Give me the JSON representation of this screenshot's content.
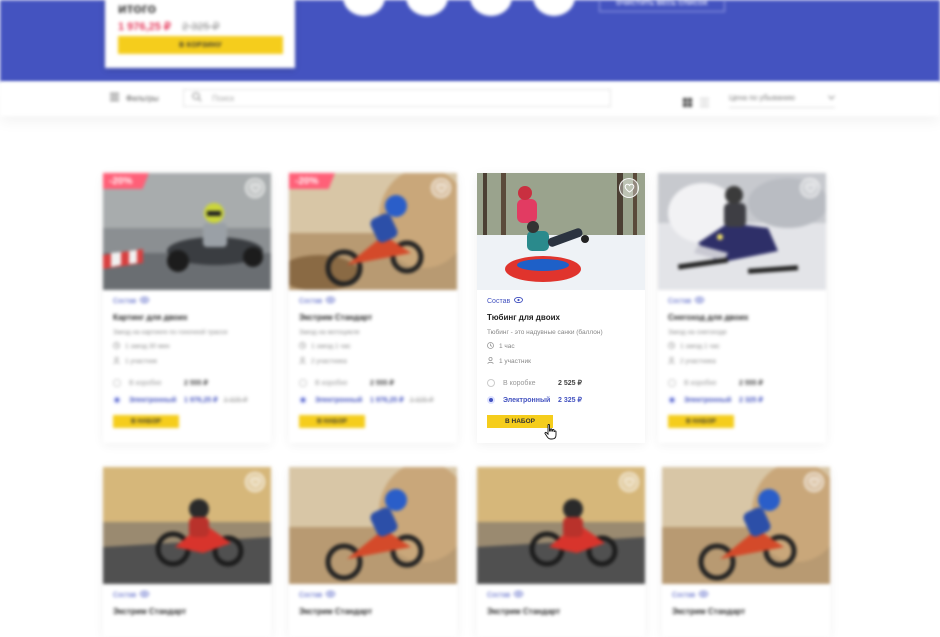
{
  "summary": {
    "title": "итого",
    "price_new": "1 976,25 ₽",
    "price_old": "2 325 ₽",
    "cart_button": "В КОРЗИНУ"
  },
  "header": {
    "clear_button": "ОЧИСТИТЬ ВЕСЬ СПИСОК"
  },
  "toolbar": {
    "filters_label": "Фильтры",
    "search_placeholder": "Поиск",
    "sort_label": "Цена по убыванию"
  },
  "colors": {
    "brand_blue": "#4453c0",
    "accent_yellow": "#f5cd1c",
    "discount_pink": "#ff6078",
    "price_red": "#e53a5c"
  },
  "cards": [
    {
      "badge": "-20%",
      "sostav": "Состав",
      "title": "Картинг для двоих",
      "desc": "Заезд на картинге по гоночной трассе",
      "duration": "1 заезд 30 мин",
      "participants": "1 участник",
      "opt1_label": "В коробке",
      "opt1_price": "2 555 ₽",
      "opt2_label": "Электронный",
      "opt2_price": "1 976,25 ₽",
      "opt2_old": "2 325 ₽",
      "button": "В НАБОР",
      "image": "go-kart-photo"
    },
    {
      "badge": "-20%",
      "sostav": "Состав",
      "title": "Экстрим Стандарт",
      "desc": "Заезд на мотоцикле",
      "duration": "1 заезд 1 час",
      "participants": "2 участника",
      "opt1_label": "В коробке",
      "opt1_price": "2 555 ₽",
      "opt2_label": "Электронный",
      "opt2_price": "1 976,25 ₽",
      "opt2_old": "2 325 ₽",
      "button": "В НАБОР",
      "image": "motocross-photo"
    },
    {
      "sostav": "Состав",
      "title": "Тюбинг для двоих",
      "desc": "Тюбинг - это надувные санки (баллон)",
      "duration": "1 час",
      "participants": "1 участник",
      "opt1_label": "В коробке",
      "opt1_price": "2 525 ₽",
      "opt2_label": "Электронный",
      "opt2_price": "2 325 ₽",
      "button": "В НАБОР",
      "image": "snow-tubing-photo"
    },
    {
      "sostav": "Состав",
      "title": "Снегоход для двоих",
      "desc": "Заезд на снегоходе",
      "duration": "1 заезд 1 час",
      "participants": "2 участника",
      "opt1_label": "В коробке",
      "opt1_price": "2 555 ₽",
      "opt2_label": "Электронный",
      "opt2_price": "2 325 ₽",
      "button": "В НАБОР",
      "image": "snowmobile-photo"
    }
  ],
  "row2": [
    {
      "sostav": "Состав",
      "title": "Экстрим Стандарт",
      "image": "motorcycle-road-photo"
    },
    {
      "sostav": "Состав",
      "title": "Экстрим Стандарт",
      "image": "motocross-photo"
    },
    {
      "sostav": "Состав",
      "title": "Экстрим Стандарт",
      "image": "motorcycle-road-photo"
    },
    {
      "sostav": "Состав",
      "title": "Экстрим Стандарт",
      "image": "motocross-photo"
    }
  ]
}
